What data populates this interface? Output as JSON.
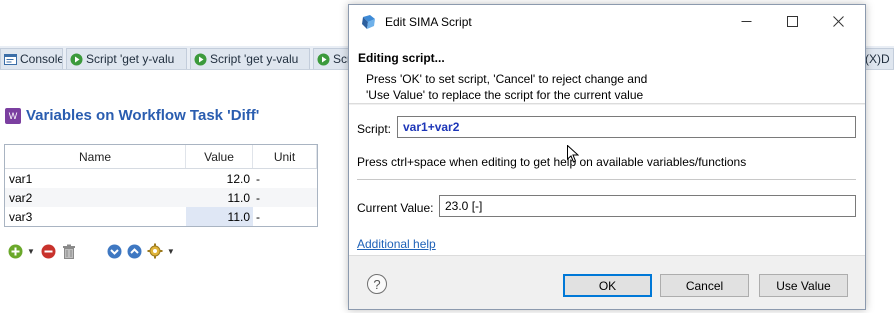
{
  "background_tabs": [
    {
      "label": "Console",
      "icon": "console-icon"
    },
    {
      "label": "Script 'get y-valu",
      "icon": "run-script-icon"
    },
    {
      "label": "Script 'get y-valu",
      "icon": "run-script-icon"
    },
    {
      "label": "Scr",
      "icon": "run-script-icon"
    }
  ],
  "right_tab": {
    "label": "D",
    "prefix": "(X)"
  },
  "workflow": {
    "icon_letter": "W",
    "title": "Variables on Workflow Task 'Diff'"
  },
  "variables_table": {
    "columns": [
      "Name",
      "Value",
      "Unit"
    ],
    "rows": [
      {
        "name": "var1",
        "value": "12.0",
        "unit": "-"
      },
      {
        "name": "var2",
        "value": "11.0",
        "unit": "-"
      },
      {
        "name": "var3",
        "value": "11.0",
        "unit": "-"
      }
    ]
  },
  "dialog": {
    "title": "Edit SIMA Script",
    "heading": "Editing script...",
    "message_line1": "Press 'OK' to set script, 'Cancel' to reject change and",
    "message_line2": "'Use Value' to replace the script for the current value",
    "script_label": "Script:",
    "script_value": "var1+var2",
    "hint": "Press ctrl+space when editing to get help on available variables/functions",
    "current_value_label": "Current Value:",
    "current_value": "23.0 [-]",
    "additional_help_link": "Additional help",
    "buttons": {
      "ok": "OK",
      "cancel": "Cancel",
      "use_value": "Use Value"
    },
    "help_glyph": "?"
  },
  "colors": {
    "title_blue": "#2a5db0",
    "script_blue": "#1d36b8",
    "link_blue": "#1f62b8",
    "default_button_border": "#0078d7"
  }
}
